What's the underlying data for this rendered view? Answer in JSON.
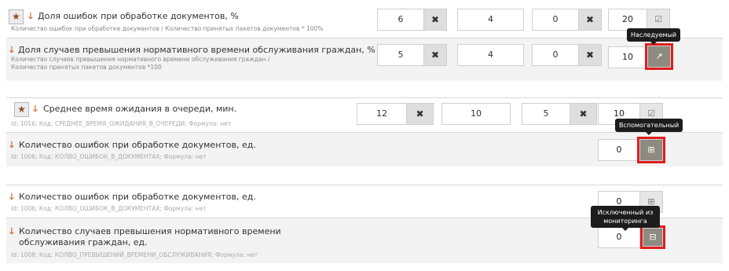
{
  "rows": [
    {
      "title": "Доля ошибок при обработке документов, %",
      "subtitle": "Количество ошибок при обработке документов / Количество принятых пакетов документов * 100%",
      "values": [
        "6",
        "4",
        "0",
        "20"
      ]
    },
    {
      "title": "Доля случаев превышения нормативного времени обслуживания граждан, %",
      "subtitle": "Количество случаев превышения нормативного времени обслуживания граждан / Количество принятых пакетов документов *100",
      "values": [
        "5",
        "4",
        "0",
        "10"
      ]
    },
    {
      "title": "Среднее время ожидания в очереди, мин.",
      "subtitle": "Id: 1016; Код: СРЕДНЕЕ_ВРЕМЯ_ОЖИДАНИЯ_В_ОЧЕРЕДИ; Формула: нет",
      "values": [
        "12",
        "10",
        "5",
        "10"
      ]
    },
    {
      "title": "Количество ошибок при обработке документов, ед.",
      "subtitle": "Id: 1006; Код: КОЛВО_ОШИБОК_В_ДОКУМЕНТАХ; Формула: нет",
      "value": "0"
    },
    {
      "title": "Количество ошибок при обработке документов, ед.",
      "subtitle": "Id: 1006; Код: КОЛВО_ОШИБОК_В_ДОКУМЕНТАХ; Формула: нет",
      "value": "0"
    },
    {
      "title": "Количество случаев превышения нормативного времени обслуживания граждан, ед.",
      "subtitle": "Id: 1008; Код: КОЛВО_ПРЕВЫШЕНИЙ_ВРЕМЕНИ_ОБСЛУЖИВАНИЯ; Формула: нет",
      "value": "0"
    }
  ],
  "tooltips": {
    "inherited": "Наследуемый",
    "auxiliary": "Вспомогательный",
    "excluded": "Исключенный из мониторинга"
  },
  "glyphs": {
    "star": "★",
    "arrow": "🡓",
    "x": "✖",
    "check": "☑",
    "external": "↗",
    "plus": "⊞",
    "minus": "⊟"
  },
  "colors": {
    "highlight": "#e01e1e",
    "arrow": "#c8642a",
    "dark_button": "#8d8a80"
  }
}
